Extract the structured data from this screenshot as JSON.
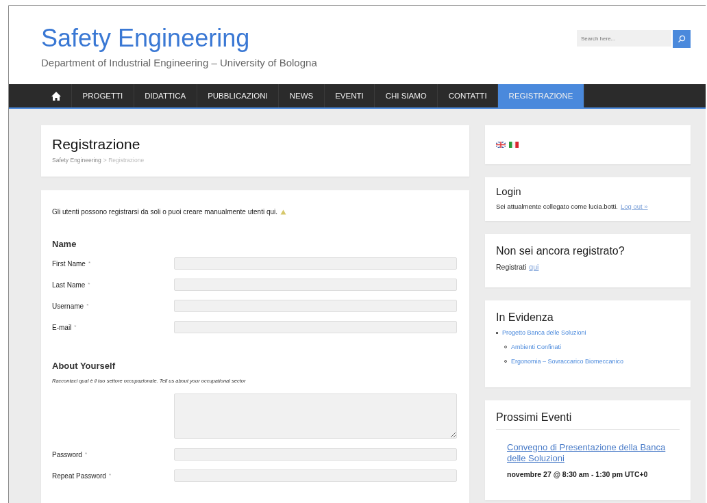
{
  "header": {
    "title": "Safety Engineering",
    "subtitle": "Department of Industrial Engineering – University of Bologna",
    "search": {
      "placeholder": "Search here..."
    }
  },
  "nav": [
    {
      "kind": "home",
      "selected": false
    },
    {
      "label": "PROGETTI",
      "selected": false
    },
    {
      "label": "DIDATTICA",
      "selected": false
    },
    {
      "label": "PUBBLICAZIONI",
      "selected": false
    },
    {
      "label": "NEWS",
      "selected": false
    },
    {
      "label": "EVENTI",
      "selected": false
    },
    {
      "label": "CHI SIAMO",
      "selected": false
    },
    {
      "label": "CONTATTI",
      "selected": false
    },
    {
      "label": "REGISTRAZIONE",
      "selected": true
    }
  ],
  "page": {
    "title": "Registrazione",
    "breadcrumb": [
      {
        "label": "Safety Engineering",
        "kind": "link"
      },
      {
        "label": "> Registrazione",
        "kind": "current"
      }
    ]
  },
  "form": {
    "intro": "Gli utenti possono registrarsi da soli o puoi creare manualmente utenti qui.",
    "sections": [
      {
        "heading": "Name",
        "fields": [
          {
            "kind": "text",
            "label": "First Name",
            "mark": "*"
          },
          {
            "kind": "text",
            "label": "Last Name",
            "mark": "*"
          },
          {
            "kind": "text",
            "label": "Username",
            "mark": "*"
          },
          {
            "kind": "text",
            "label": "E-mail",
            "mark": "*"
          }
        ]
      },
      {
        "heading": "About Yourself",
        "note": "Raccontaci qual è il tuo settore occupazionale. Tell us about your occupational sector",
        "fields": [
          {
            "kind": "textarea"
          },
          {
            "kind": "password",
            "label": "Password",
            "mark": "*"
          },
          {
            "kind": "password",
            "label": "Repeat Password",
            "mark": "*"
          }
        ]
      }
    ]
  },
  "sidebar": [
    {
      "kind": "languages",
      "flags": [
        {
          "kind": "uk"
        },
        {
          "kind": "italy"
        }
      ]
    },
    {
      "kind": "login",
      "title": "Login",
      "text": "Sei attualmente collegato come lucia.botti.",
      "link": "Log out »"
    },
    {
      "kind": "register",
      "title": "Non sei ancora registrato?",
      "text": "Registrati",
      "link": "qui"
    },
    {
      "kind": "list",
      "title": "In Evidenza",
      "items": [
        {
          "label": "Progetto Banca delle Soluzioni",
          "children": [
            {
              "label": "Ambienti Confinati"
            },
            {
              "label": "Ergonomia – Sovraccarico Biomeccanico"
            }
          ]
        }
      ]
    },
    {
      "kind": "events",
      "title": "Prossimi Eventi",
      "events": [
        {
          "title": "Convegno di Presentazione della Banca delle Soluzioni",
          "when": "novembre 27 @ 8:30 am - 1:30 pm UTC+0"
        }
      ]
    }
  ]
}
